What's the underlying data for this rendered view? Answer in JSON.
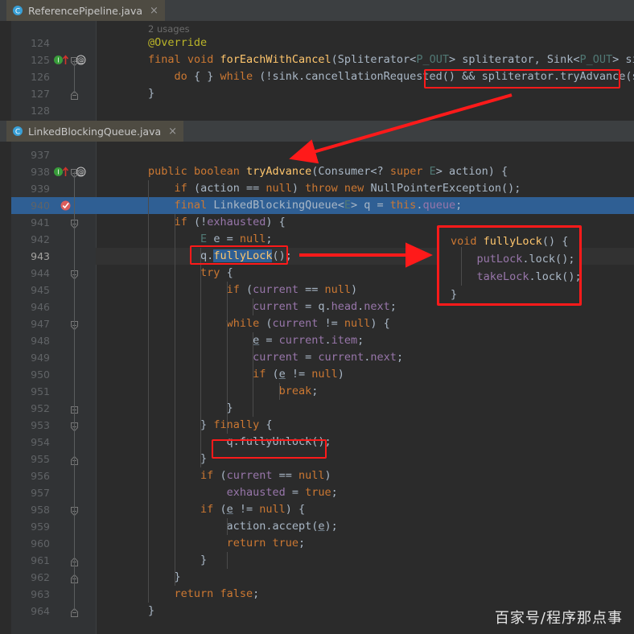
{
  "window": {
    "theme_bg": "#2b2b2b",
    "accent_selection": "#2f5f94",
    "annotation_color": "#ff1a1a"
  },
  "tabs": [
    {
      "label": "ReferencePipeline.java",
      "icon": "java-class-icon",
      "close_label": "×",
      "active": true
    },
    {
      "label": "LinkedBlockingQueue.java",
      "icon": "java-class-icon",
      "close_label": "×",
      "active": true
    }
  ],
  "top_editor": {
    "inlay_hint": "2 usages",
    "lines": [
      {
        "num": "124",
        "tokens": [
          {
            "t": "        ",
            "c": "id"
          },
          {
            "t": "@Override",
            "c": "ann"
          }
        ]
      },
      {
        "num": "125",
        "tokens": [
          {
            "t": "        ",
            "c": "id"
          },
          {
            "t": "final",
            "c": "kw"
          },
          {
            "t": " ",
            "c": "id"
          },
          {
            "t": "void",
            "c": "kw"
          },
          {
            "t": " ",
            "c": "id"
          },
          {
            "t": "forEachWithCancel",
            "c": "mth"
          },
          {
            "t": "(Spliterator<",
            "c": "id"
          },
          {
            "t": "P_OUT",
            "c": "gen"
          },
          {
            "t": "> spliterator, Sink<",
            "c": "id"
          },
          {
            "t": "P_OUT",
            "c": "gen"
          },
          {
            "t": "> sink) {",
            "c": "id"
          }
        ]
      },
      {
        "num": "126",
        "tokens": [
          {
            "t": "            ",
            "c": "id"
          },
          {
            "t": "do",
            "c": "kw"
          },
          {
            "t": " { } ",
            "c": "id"
          },
          {
            "t": "while",
            "c": "kw"
          },
          {
            "t": " (!sink.cancellationRequested() && spliterator.tryAdvance(sink));",
            "c": "id"
          }
        ]
      },
      {
        "num": "127",
        "tokens": [
          {
            "t": "        }",
            "c": "id"
          }
        ]
      },
      {
        "num": "128",
        "tokens": []
      }
    ],
    "gutter_markers": [
      {
        "line": "125",
        "icons": [
          "implementing-method-icon",
          "overriding-method-icon",
          "annotation-icon"
        ]
      }
    ]
  },
  "bottom_editor": {
    "lines": [
      {
        "num": "937",
        "tokens": []
      },
      {
        "num": "938",
        "tokens": [
          {
            "t": "        ",
            "c": "id"
          },
          {
            "t": "public",
            "c": "kw"
          },
          {
            "t": " ",
            "c": "id"
          },
          {
            "t": "boolean",
            "c": "kw"
          },
          {
            "t": " ",
            "c": "id"
          },
          {
            "t": "tryAdvance",
            "c": "mth"
          },
          {
            "t": "(Consumer<? ",
            "c": "id"
          },
          {
            "t": "super",
            "c": "kw"
          },
          {
            "t": " ",
            "c": "id"
          },
          {
            "t": "E",
            "c": "gen"
          },
          {
            "t": "> action) {",
            "c": "id"
          }
        ]
      },
      {
        "num": "939",
        "tokens": [
          {
            "t": "            ",
            "c": "id"
          },
          {
            "t": "if",
            "c": "kw"
          },
          {
            "t": " (action == ",
            "c": "id"
          },
          {
            "t": "null",
            "c": "kw"
          },
          {
            "t": ") ",
            "c": "id"
          },
          {
            "t": "throw",
            "c": "kw"
          },
          {
            "t": " ",
            "c": "id"
          },
          {
            "t": "new",
            "c": "kw"
          },
          {
            "t": " NullPointerException();",
            "c": "id"
          }
        ]
      },
      {
        "num": "940",
        "tokens": [
          {
            "t": "            ",
            "c": "id"
          },
          {
            "t": "final",
            "c": "kw"
          },
          {
            "t": " LinkedBlockingQueue<",
            "c": "id"
          },
          {
            "t": "E",
            "c": "gen"
          },
          {
            "t": "> q = ",
            "c": "id"
          },
          {
            "t": "this",
            "c": "kw"
          },
          {
            "t": ".",
            "c": "id"
          },
          {
            "t": "queue",
            "c": "fld"
          },
          {
            "t": ";",
            "c": "id"
          }
        ],
        "selected": true
      },
      {
        "num": "941",
        "tokens": [
          {
            "t": "            ",
            "c": "id"
          },
          {
            "t": "if",
            "c": "kw"
          },
          {
            "t": " (!",
            "c": "id"
          },
          {
            "t": "exhausted",
            "c": "fld"
          },
          {
            "t": ") {",
            "c": "id"
          }
        ]
      },
      {
        "num": "942",
        "tokens": [
          {
            "t": "                ",
            "c": "id"
          },
          {
            "t": "E",
            "c": "gen"
          },
          {
            "t": " e = ",
            "c": "id"
          },
          {
            "t": "null",
            "c": "kw"
          },
          {
            "t": ";",
            "c": "id"
          }
        ]
      },
      {
        "num": "943",
        "tokens": [
          {
            "t": "                q.",
            "c": "id"
          },
          {
            "t": "fullyLock",
            "c": "sel"
          },
          {
            "t": "();",
            "c": "id"
          }
        ],
        "current": true
      },
      {
        "num": "944",
        "tokens": [
          {
            "t": "                ",
            "c": "id"
          },
          {
            "t": "try",
            "c": "kw"
          },
          {
            "t": " {",
            "c": "id"
          }
        ]
      },
      {
        "num": "945",
        "tokens": [
          {
            "t": "                    ",
            "c": "id"
          },
          {
            "t": "if",
            "c": "kw"
          },
          {
            "t": " (",
            "c": "id"
          },
          {
            "t": "current",
            "c": "fld"
          },
          {
            "t": " == ",
            "c": "id"
          },
          {
            "t": "null",
            "c": "kw"
          },
          {
            "t": ")",
            "c": "id"
          }
        ]
      },
      {
        "num": "946",
        "tokens": [
          {
            "t": "                        ",
            "c": "id"
          },
          {
            "t": "current",
            "c": "fld"
          },
          {
            "t": " = q.",
            "c": "id"
          },
          {
            "t": "head",
            "c": "fld"
          },
          {
            "t": ".",
            "c": "id"
          },
          {
            "t": "next",
            "c": "fld"
          },
          {
            "t": ";",
            "c": "id"
          }
        ]
      },
      {
        "num": "947",
        "tokens": [
          {
            "t": "                    ",
            "c": "id"
          },
          {
            "t": "while",
            "c": "kw"
          },
          {
            "t": " (",
            "c": "id"
          },
          {
            "t": "current",
            "c": "fld"
          },
          {
            "t": " != ",
            "c": "id"
          },
          {
            "t": "null",
            "c": "kw"
          },
          {
            "t": ") {",
            "c": "id"
          }
        ]
      },
      {
        "num": "948",
        "tokens": [
          {
            "t": "                        ",
            "c": "id"
          },
          {
            "t": "e",
            "c": "und"
          },
          {
            "t": " = ",
            "c": "id"
          },
          {
            "t": "current",
            "c": "fld"
          },
          {
            "t": ".",
            "c": "id"
          },
          {
            "t": "item",
            "c": "fld"
          },
          {
            "t": ";",
            "c": "id"
          }
        ]
      },
      {
        "num": "949",
        "tokens": [
          {
            "t": "                        ",
            "c": "id"
          },
          {
            "t": "current",
            "c": "fld"
          },
          {
            "t": " = ",
            "c": "id"
          },
          {
            "t": "current",
            "c": "fld"
          },
          {
            "t": ".",
            "c": "id"
          },
          {
            "t": "next",
            "c": "fld"
          },
          {
            "t": ";",
            "c": "id"
          }
        ]
      },
      {
        "num": "950",
        "tokens": [
          {
            "t": "                        ",
            "c": "id"
          },
          {
            "t": "if",
            "c": "kw"
          },
          {
            "t": " (",
            "c": "id"
          },
          {
            "t": "e",
            "c": "und"
          },
          {
            "t": " != ",
            "c": "id"
          },
          {
            "t": "null",
            "c": "kw"
          },
          {
            "t": ")",
            "c": "id"
          }
        ]
      },
      {
        "num": "951",
        "tokens": [
          {
            "t": "                            ",
            "c": "id"
          },
          {
            "t": "break",
            "c": "kw"
          },
          {
            "t": ";",
            "c": "id"
          }
        ]
      },
      {
        "num": "952",
        "tokens": [
          {
            "t": "                    }",
            "c": "id"
          }
        ]
      },
      {
        "num": "953",
        "tokens": [
          {
            "t": "                } ",
            "c": "id"
          },
          {
            "t": "finally",
            "c": "kw"
          },
          {
            "t": " {",
            "c": "id"
          }
        ]
      },
      {
        "num": "954",
        "tokens": [
          {
            "t": "                    q.fullyUnlock();",
            "c": "id"
          }
        ]
      },
      {
        "num": "955",
        "tokens": [
          {
            "t": "                }",
            "c": "id"
          }
        ]
      },
      {
        "num": "956",
        "tokens": [
          {
            "t": "                ",
            "c": "id"
          },
          {
            "t": "if",
            "c": "kw"
          },
          {
            "t": " (",
            "c": "id"
          },
          {
            "t": "current",
            "c": "fld"
          },
          {
            "t": " == ",
            "c": "id"
          },
          {
            "t": "null",
            "c": "kw"
          },
          {
            "t": ")",
            "c": "id"
          }
        ]
      },
      {
        "num": "957",
        "tokens": [
          {
            "t": "                    ",
            "c": "id"
          },
          {
            "t": "exhausted",
            "c": "fld"
          },
          {
            "t": " = ",
            "c": "id"
          },
          {
            "t": "true",
            "c": "kw"
          },
          {
            "t": ";",
            "c": "id"
          }
        ]
      },
      {
        "num": "958",
        "tokens": [
          {
            "t": "                ",
            "c": "id"
          },
          {
            "t": "if",
            "c": "kw"
          },
          {
            "t": " (",
            "c": "id"
          },
          {
            "t": "e",
            "c": "und"
          },
          {
            "t": " != ",
            "c": "id"
          },
          {
            "t": "null",
            "c": "kw"
          },
          {
            "t": ") {",
            "c": "id"
          }
        ]
      },
      {
        "num": "959",
        "tokens": [
          {
            "t": "                    action.accept(",
            "c": "id"
          },
          {
            "t": "e",
            "c": "und"
          },
          {
            "t": ");",
            "c": "id"
          }
        ]
      },
      {
        "num": "960",
        "tokens": [
          {
            "t": "                    ",
            "c": "id"
          },
          {
            "t": "return",
            "c": "kw"
          },
          {
            "t": " ",
            "c": "id"
          },
          {
            "t": "true",
            "c": "kw"
          },
          {
            "t": ";",
            "c": "id"
          }
        ]
      },
      {
        "num": "961",
        "tokens": [
          {
            "t": "                }",
            "c": "id"
          }
        ]
      },
      {
        "num": "962",
        "tokens": [
          {
            "t": "            }",
            "c": "id"
          }
        ]
      },
      {
        "num": "963",
        "tokens": [
          {
            "t": "            ",
            "c": "id"
          },
          {
            "t": "return",
            "c": "kw"
          },
          {
            "t": " ",
            "c": "id"
          },
          {
            "t": "false",
            "c": "kw"
          },
          {
            "t": ";",
            "c": "id"
          }
        ]
      },
      {
        "num": "964",
        "tokens": [
          {
            "t": "        }",
            "c": "id"
          }
        ]
      }
    ],
    "gutter_markers": [
      {
        "line": "938",
        "icons": [
          "implementing-method-icon",
          "overriding-method-icon",
          "annotation-icon"
        ]
      },
      {
        "line": "940",
        "icons": [
          "breakpoint-verified-icon"
        ]
      }
    ]
  },
  "annotations": {
    "callout": {
      "lines": [
        [
          {
            "t": "void",
            "c": "kw"
          },
          {
            "t": " ",
            "c": "id"
          },
          {
            "t": "fullyLock",
            "c": "mth"
          },
          {
            "t": "() {",
            "c": "id"
          }
        ],
        [
          {
            "t": "    ",
            "c": "id"
          },
          {
            "t": "putLock",
            "c": "fld"
          },
          {
            "t": ".lock();",
            "c": "id"
          }
        ],
        [
          {
            "t": "    ",
            "c": "id"
          },
          {
            "t": "takeLock",
            "c": "fld"
          },
          {
            "t": ".lock();",
            "c": "id"
          }
        ],
        [
          {
            "t": "}",
            "c": "id"
          }
        ]
      ]
    },
    "boxes": [
      {
        "name": "highlight-box-tryadvance-call"
      },
      {
        "name": "highlight-box-fullylock-call"
      },
      {
        "name": "highlight-box-fullyunlock-call"
      },
      {
        "name": "highlight-box-fullylock-definition"
      }
    ],
    "arrows": [
      {
        "name": "arrow-tryadvance-to-definition"
      },
      {
        "name": "arrow-fullylock-to-definition"
      }
    ]
  },
  "watermark": {
    "text": "百家号/程序那点事"
  }
}
